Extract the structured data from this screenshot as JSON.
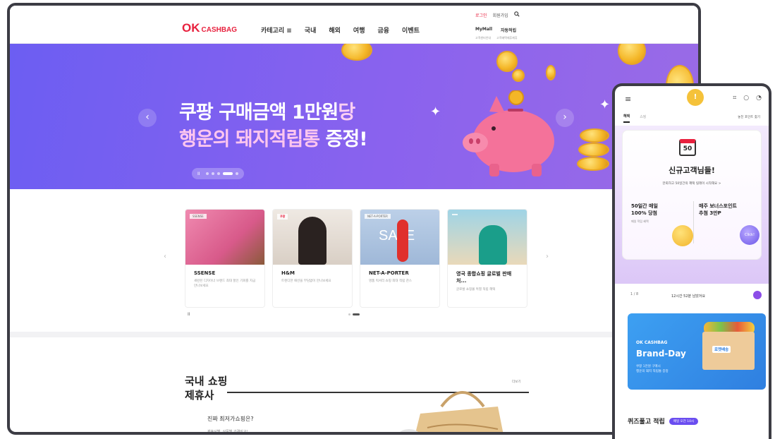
{
  "brand": {
    "logo_main": "OK",
    "logo_sub": "CASHBAG"
  },
  "nav": {
    "items": [
      "카테고리 ≡",
      "국내",
      "해외",
      "여행",
      "금융",
      "이벤트"
    ],
    "util_login": "로그인",
    "util_join": "회원가입",
    "util_row2": [
      "MyMall",
      "자동적립"
    ],
    "util_row3": [
      "고객센터안내",
      "고객혜택제휴제휴"
    ]
  },
  "hero": {
    "line1_main": "쿠팡 구매금액 1만원",
    "line1_accent": "당",
    "line2_pink": "행운의 돼지적립통",
    "line2_white": " 증정!",
    "prev_arrow": "‹",
    "next_arrow": "›",
    "pause": "II"
  },
  "cards": [
    {
      "tag": "SSENSE",
      "name": "SSENSE",
      "desc": "세련된 디자이너 브랜드 최대 할인 기회를 지금 만나보세요"
    },
    {
      "tag": "쿠팡",
      "name": "H&M",
      "desc": "트렌디한 패션을 부담없이 만나보세요"
    },
    {
      "tag": "NET-A-PORTER",
      "name": "NET-A-PORTER",
      "desc": "명품 럭셔리 쇼핑 최대 적립 찬스"
    },
    {
      "tag": "",
      "name": "영국 종합쇼핑 글로벌 판매처...",
      "desc": "글로벌 쇼핑몰 특별 적립 혜택"
    }
  ],
  "cards_image_text": {
    "sale": "SALE"
  },
  "section": {
    "title_line1": "국내 쇼핑",
    "title_line2": "제휴사",
    "more": "더보기",
    "question": "진짜 최저가쇼핑은?",
    "sub": "제휴사별, 상품별 가격비교!"
  },
  "mobile": {
    "avatar": "!",
    "tab_active": "혜택",
    "tab_other": "쇼핑",
    "tab_right": "놓친 포인트 찾기",
    "calendar_num": "50",
    "promo_head": "신규고객님들!",
    "promo_sub": "만회하고 50일간의 혜택 릴레이 시작해요 >",
    "left_title_1": "50일간 매일",
    "left_title_2": "100% 당첨",
    "left_small": "매일 적립 혜택",
    "right_title_1": "매주 보너스포인트",
    "right_title_2": "추첨 3만P",
    "right_ball": "Click!",
    "row_left": "1 / 8",
    "row_center": "12시간 52분 남았어요",
    "brand_logo": "OK CASHBAG",
    "brand_title": "Brand-Day",
    "brand_sub_1": "쿠팡 1만원 구매시",
    "brand_sub_2": "행운의 돼지 적립통 증정",
    "brand_box_label": "로켓배송",
    "quiz_title": "퀴즈풀고 적립",
    "quiz_badge": "매일 오전 10시"
  }
}
